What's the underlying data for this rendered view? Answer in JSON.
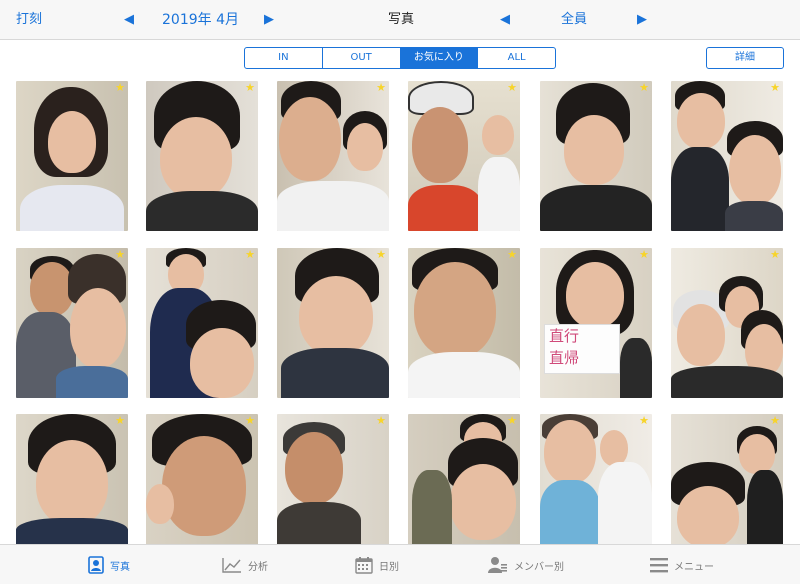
{
  "topbar": {
    "clock_label": "打刻",
    "month_label": "2019年 4月",
    "prev_month_icon": "◀",
    "next_month_icon": "▶",
    "title": "写真",
    "prev_member_icon": "◀",
    "next_member_icon": "▶",
    "member_label": "全員"
  },
  "filters": {
    "options": [
      "IN",
      "OUT",
      "お気に入り",
      "ALL"
    ],
    "selected": "お気に入り"
  },
  "detail_button": "詳細",
  "photos": [
    {
      "favorite": true,
      "star": "★"
    },
    {
      "favorite": true,
      "star": "★"
    },
    {
      "favorite": true,
      "star": "★"
    },
    {
      "favorite": true,
      "star": "★"
    },
    {
      "favorite": true,
      "star": "★"
    },
    {
      "favorite": true,
      "star": "★"
    },
    {
      "favorite": true,
      "star": "★"
    },
    {
      "favorite": true,
      "star": "★"
    },
    {
      "favorite": true,
      "star": "★"
    },
    {
      "favorite": true,
      "star": "★",
      "sign_line1": "直行",
      "sign_line2": "直帰"
    },
    {
      "favorite": true,
      "star": "★"
    },
    {
      "favorite": true,
      "star": "★"
    },
    {
      "favorite": true,
      "star": "★"
    },
    {
      "favorite": true,
      "star": "★"
    },
    {
      "favorite": true,
      "star": "★"
    },
    {
      "favorite": true,
      "star": "★"
    },
    {
      "favorite": true,
      "star": "★"
    },
    {
      "favorite": true,
      "star": "★"
    }
  ],
  "tabbar": {
    "items": [
      {
        "label": "写真",
        "icon": "photo-portrait-icon",
        "active": true
      },
      {
        "label": "分析",
        "icon": "line-chart-icon",
        "active": false
      },
      {
        "label": "日別",
        "icon": "calendar-icon",
        "active": false
      },
      {
        "label": "メンバー別",
        "icon": "member-icon",
        "active": false
      },
      {
        "label": "メニュー",
        "icon": "hamburger-menu-icon",
        "active": false
      }
    ]
  },
  "colors": {
    "accent": "#1a73d9",
    "star": "#f7d42a",
    "bar_background": "#f7f7f7"
  }
}
